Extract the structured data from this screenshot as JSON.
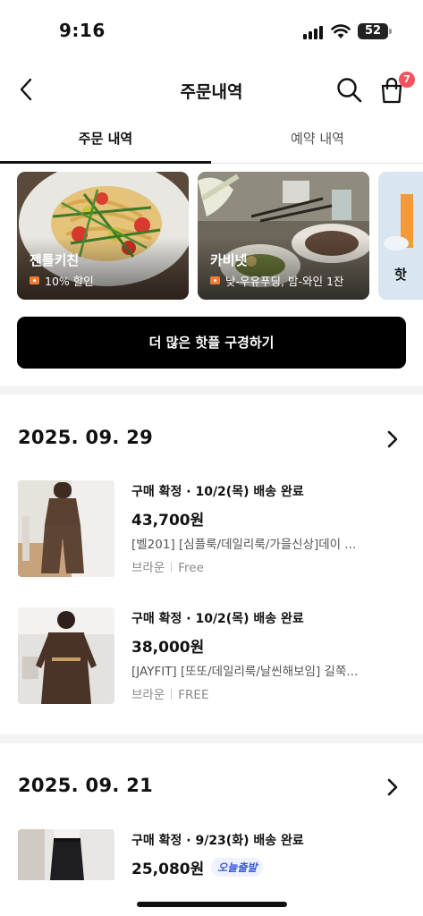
{
  "status_bar": {
    "time": "9:16",
    "battery": "52"
  },
  "header": {
    "title": "주문내역",
    "cart_count": "7"
  },
  "tabs": [
    {
      "label": "주문 내역",
      "active": true
    },
    {
      "label": "예약 내역",
      "active": false
    }
  ],
  "carousel": [
    {
      "name": "젠틀키친",
      "desc": "10% 할인"
    },
    {
      "name": "카비넷",
      "desc": "낮-우유푸딩, 밤-와인 1잔"
    },
    {
      "name": "핫"
    }
  ],
  "more_button": "더 많은 핫플 구경하기",
  "order_groups": [
    {
      "date": "2025. 09. 29",
      "items": [
        {
          "status": "구매 확정 · 10/2(목) 배송 완료",
          "price": "43,700원",
          "name": "[벨201] [심플룩/데일리룩/가을신상]데이 ...",
          "color": "브라운",
          "size": "Free"
        },
        {
          "status": "구매 확정 · 10/2(목) 배송 완료",
          "price": "38,000원",
          "name": "[JAYFIT] [또또/데일리룩/날씬해보임] 길쭉...",
          "color": "브라운",
          "size": "FREE"
        }
      ]
    },
    {
      "date": "2025. 09. 21",
      "items": [
        {
          "status": "구매 확정 · 9/23(화) 배송 완료",
          "price": "25,080원",
          "badge": "오늘출발"
        }
      ]
    }
  ],
  "colors": {
    "accent_badge": "#f4525d",
    "today_badge": "#3a5bd9"
  }
}
